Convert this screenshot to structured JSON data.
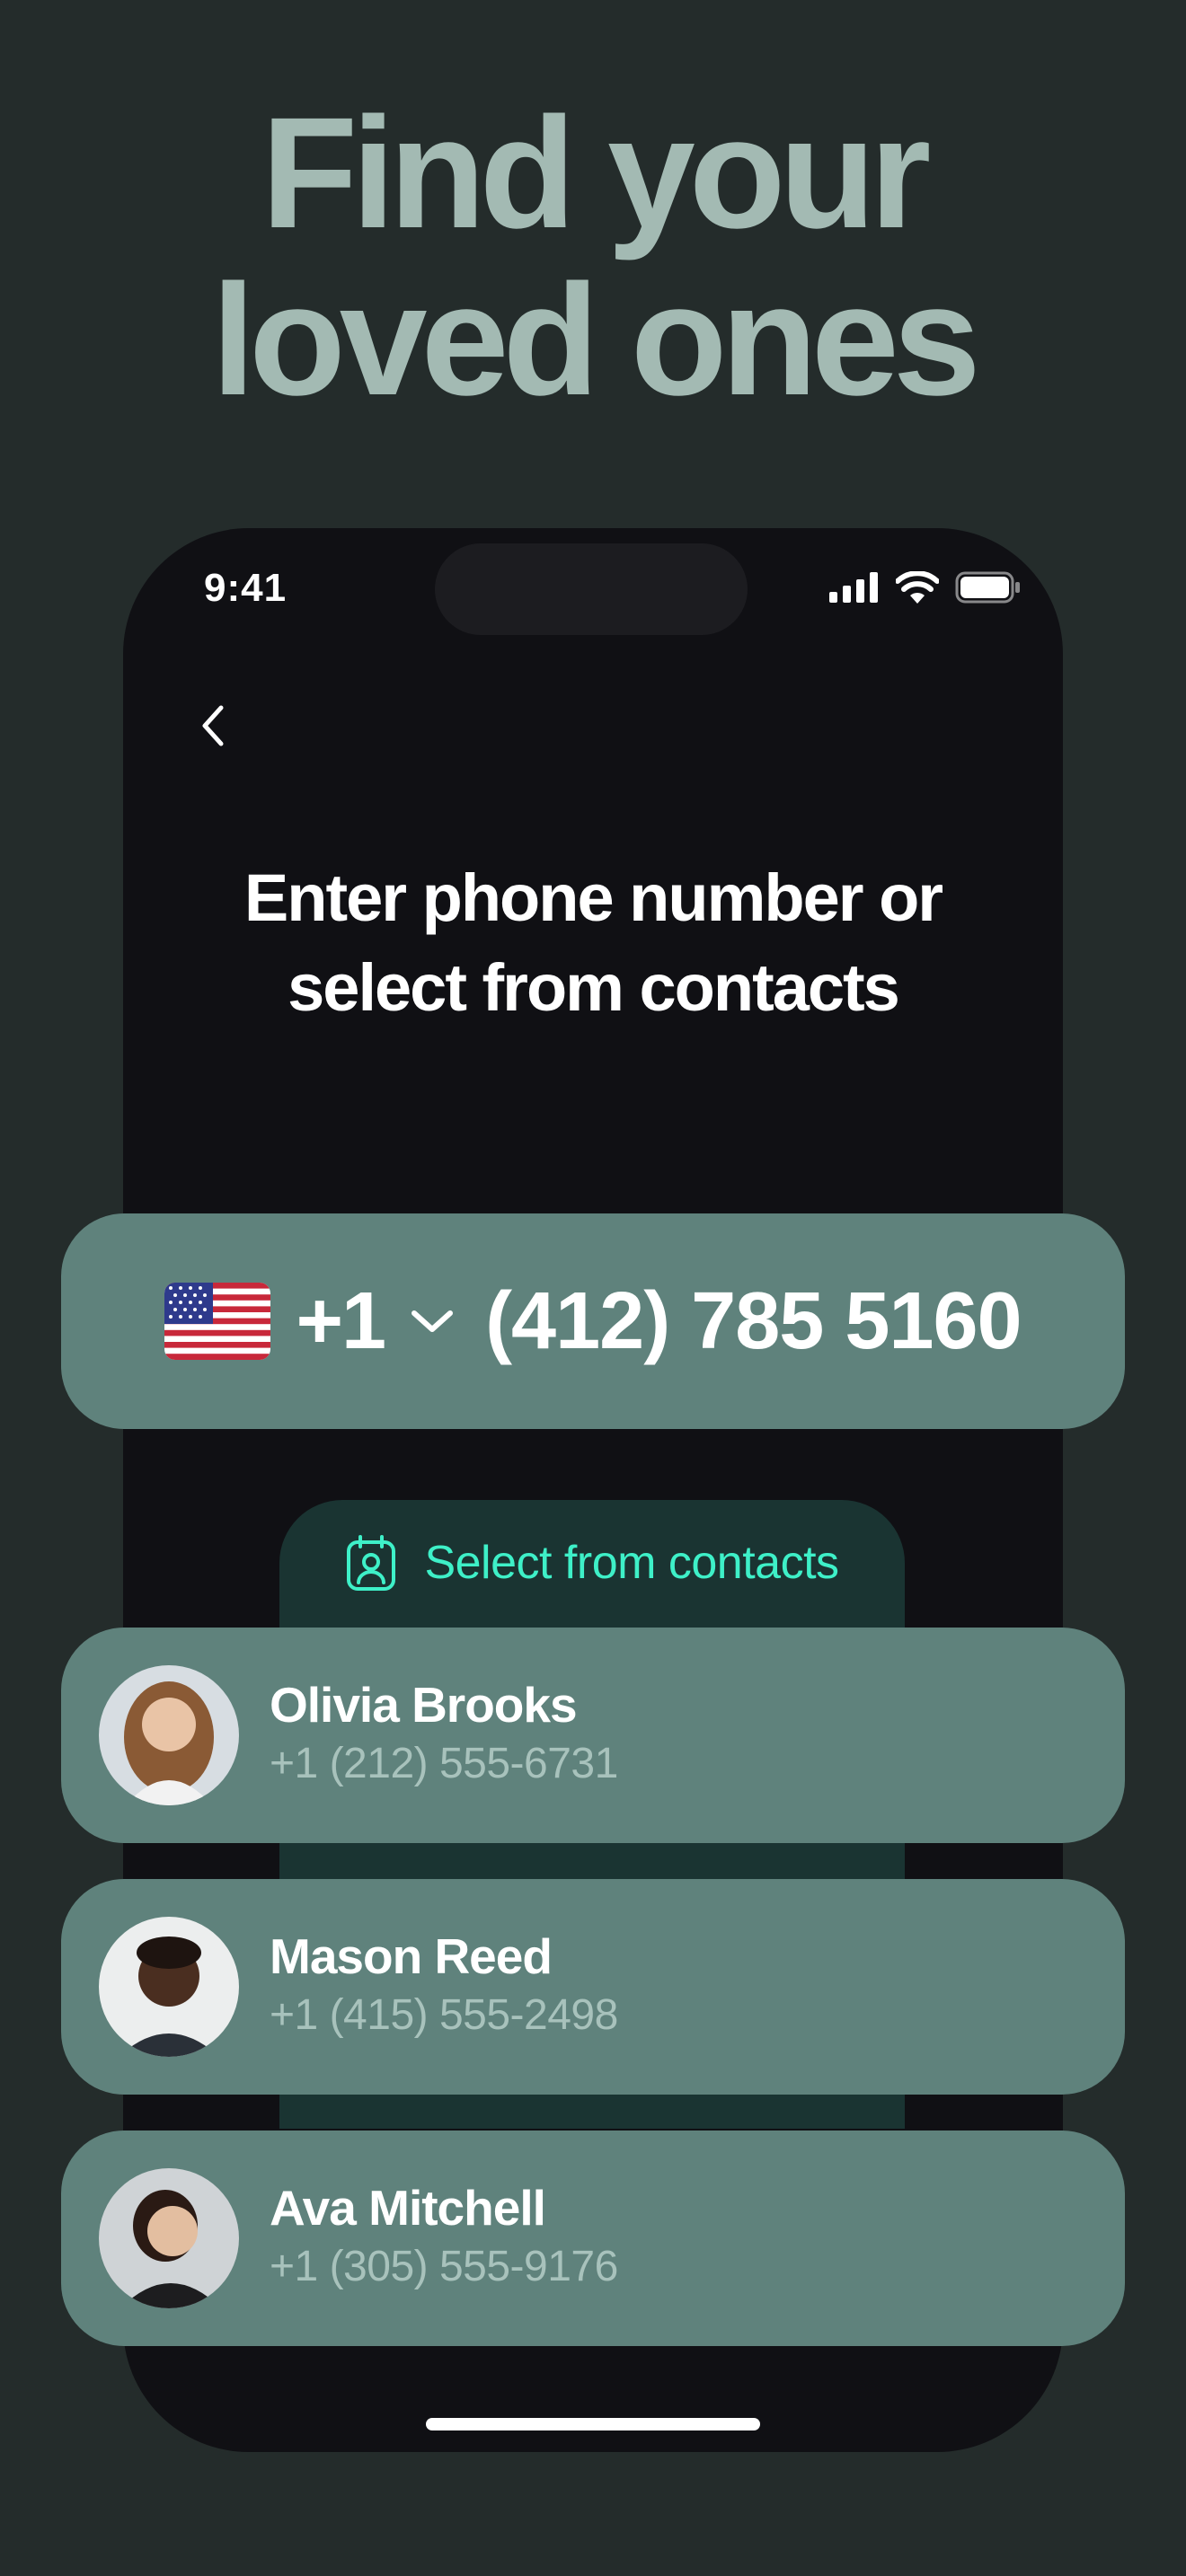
{
  "headline": {
    "line1": "Find your",
    "line2": "loved ones"
  },
  "status_bar": {
    "time": "9:41",
    "icons": [
      "cellular-signal-icon",
      "wifi-icon",
      "battery-icon"
    ]
  },
  "nav": {
    "back_icon": "chevron-left-icon"
  },
  "prompt": {
    "line1": "Enter phone number or",
    "line2": "select from contacts"
  },
  "phone_input": {
    "flag": "us-flag-icon",
    "country_code": "+1",
    "dropdown_icon": "chevron-down-icon",
    "number": "(412) 785 5160"
  },
  "select_contacts": {
    "icon": "contact-book-icon",
    "label": "Select from contacts"
  },
  "contacts": [
    {
      "name": "Olivia Brooks",
      "phone": "+1 (212) 555-6731"
    },
    {
      "name": "Mason Reed",
      "phone": "+1 (415) 555-2498"
    },
    {
      "name": "Ava Mitchell",
      "phone": "+1 (305) 555-9176"
    }
  ],
  "colors": {
    "background": "#242c2b",
    "headline": "#a3bab3",
    "card": "#5f827c",
    "accent": "#3ef0c8",
    "phone_screen": "#101014"
  }
}
